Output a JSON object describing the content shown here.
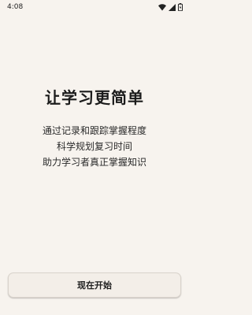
{
  "status_bar": {
    "time": "4:08",
    "icons": [
      "wifi-icon",
      "signal-icon",
      "battery-icon"
    ]
  },
  "main": {
    "title": "让学习更简单",
    "subtitle_lines": [
      "通过记录和跟踪掌握程度",
      "科学规划复习时间",
      "助力学习者真正掌握知识"
    ]
  },
  "actions": {
    "start_label": "现在开始"
  },
  "colors": {
    "background": "#f7f3ee",
    "button_background": "#f3eee8",
    "text": "#1f1f1f"
  }
}
